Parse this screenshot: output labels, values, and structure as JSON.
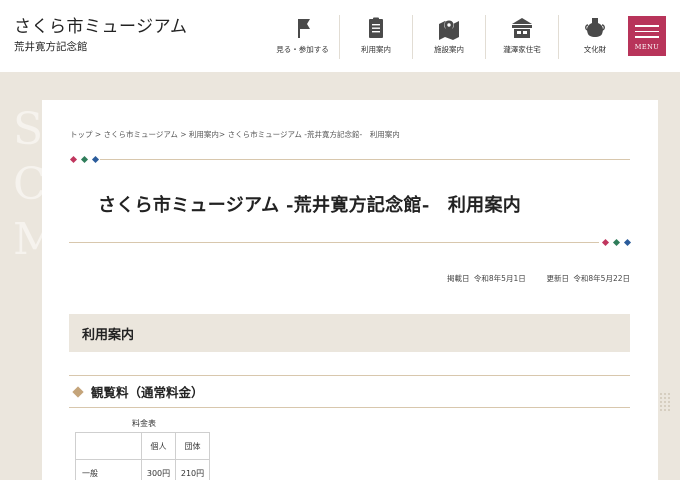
{
  "site": {
    "title": "さくら市ミュージアム",
    "subtitle": "荒井寛方記念館"
  },
  "nav": [
    {
      "label": "見る・参加する",
      "icon": "flag-icon"
    },
    {
      "label": "利用案内",
      "icon": "clipboard-icon"
    },
    {
      "label": "施設案内",
      "icon": "map-pin-icon"
    },
    {
      "label": "瀧澤家住宅",
      "icon": "house-icon"
    },
    {
      "label": "文化財",
      "icon": "pottery-vase-icon"
    }
  ],
  "menu_label": "MENU",
  "deco_letters": [
    "S",
    "C",
    "M"
  ],
  "breadcrumb": "トップ > さくら市ミュージアム > 利用案内> さくら市ミュージアム -荒井寛方記念館-　利用案内",
  "page_title": "さくら市ミュージアム -荒井寛方記念館-　利用案内",
  "dates": {
    "published_label": "掲載日",
    "published": "令和8年5月1日",
    "updated_label": "更新日",
    "updated": "令和8年5月22日"
  },
  "section_title": "利用案内",
  "subsection_title": "観覧料（通常料金）",
  "fee_table": {
    "caption": "料金表",
    "headers": [
      "",
      "個人",
      "団体"
    ],
    "rows": [
      [
        "一般",
        "300円",
        "210円"
      ]
    ]
  },
  "colors": {
    "accent_menu": "#b8345a",
    "deco_red": "#c0365e",
    "deco_green": "#2f7d5a",
    "deco_blue": "#2b5c9b",
    "beige": "#ebe6dd",
    "tan": "#c4a47a"
  }
}
